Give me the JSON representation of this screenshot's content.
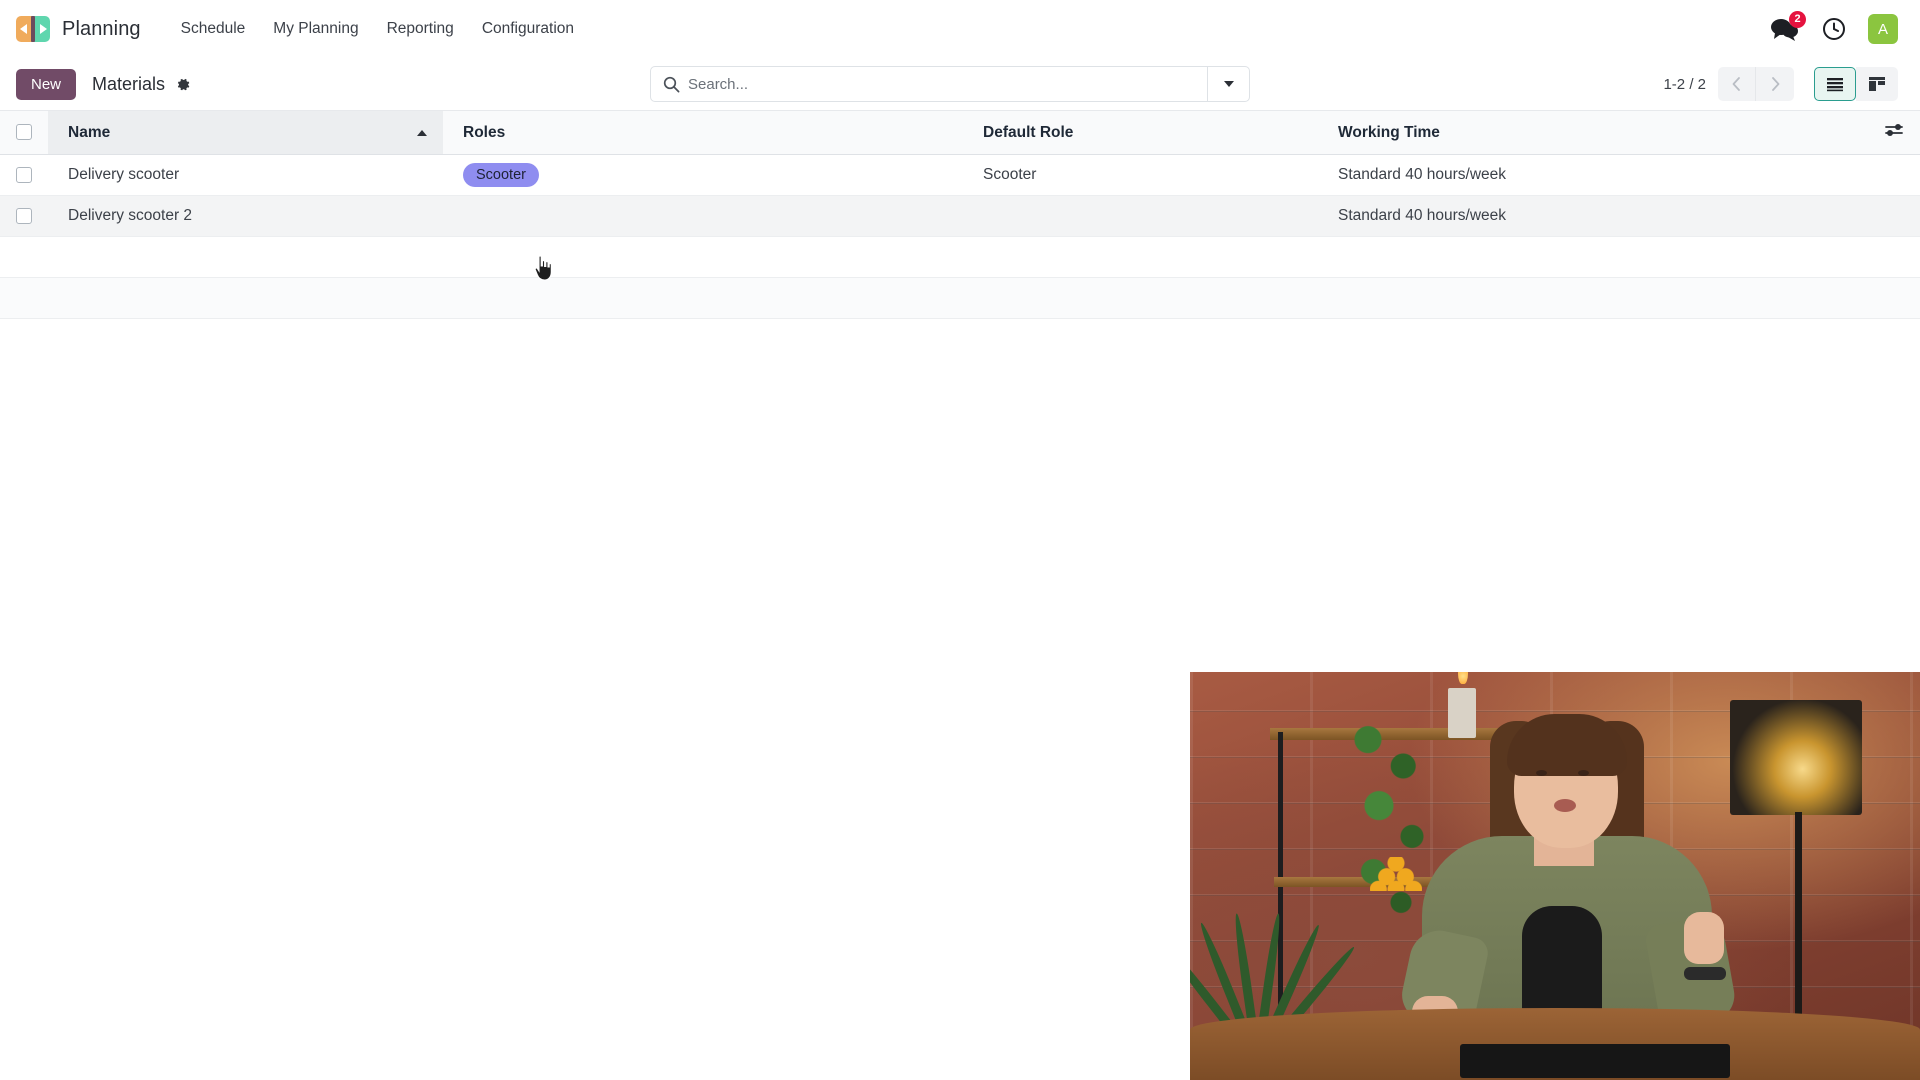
{
  "navbar": {
    "brand": "Planning",
    "logo_icon": "planning-logo-icon",
    "menu": [
      {
        "label": "Schedule"
      },
      {
        "label": "My Planning"
      },
      {
        "label": "Reporting"
      },
      {
        "label": "Configuration"
      }
    ],
    "messages_icon": "chat-bubbles-icon",
    "messages_count": "2",
    "activity_icon": "clock-icon",
    "avatar_initial": "A",
    "colors": {
      "badge": "#e5133f",
      "avatar": "#8bc53f",
      "logo_left": "#f0ab5c",
      "logo_right": "#5fd6ae"
    }
  },
  "control_panel": {
    "new_button": "New",
    "breadcrumb_title": "Materials",
    "settings_icon": "gear-icon",
    "search": {
      "placeholder": "Search...",
      "value": "",
      "search_icon": "search-icon",
      "dropdown_icon": "chevron-down-icon"
    },
    "pager": {
      "range": "1-2 / 2",
      "previous_icon": "chevron-left-icon",
      "next_icon": "chevron-right-icon"
    },
    "views": [
      {
        "name": "list",
        "icon": "list-view-icon",
        "active": true
      },
      {
        "name": "kanban",
        "icon": "kanban-view-icon",
        "active": false
      }
    ],
    "new_button_color": "#714b67",
    "active_view_color": "#2a9d8f"
  },
  "table": {
    "select_all_icon": "checkbox-icon",
    "optional_columns_icon": "sliders-icon",
    "sort_icon": "sort-ascending-caret-icon",
    "columns": [
      {
        "label": "Name",
        "sorted": true
      },
      {
        "label": "Roles",
        "sorted": false
      },
      {
        "label": "Default Role",
        "sorted": false
      },
      {
        "label": "Working Time",
        "sorted": false
      }
    ],
    "rows": [
      {
        "name": "Delivery scooter",
        "roles": [
          "Scooter"
        ],
        "default_role": "Scooter",
        "working_time": "Standard 40 hours/week",
        "hovered": false
      },
      {
        "name": "Delivery scooter 2",
        "roles": [],
        "default_role": "",
        "working_time": "Standard 40 hours/week",
        "hovered": true
      }
    ],
    "role_badge_color": "#8f8df0"
  },
  "video_overlay": {
    "name": "presenter-video-overlay",
    "description": "Video of a presenter seated at a wooden desk in front of a brick wall with plants, shelf, candle and lamp"
  },
  "cursor": {
    "name": "pointer-cursor",
    "icon": "hand-pointer-icon"
  }
}
